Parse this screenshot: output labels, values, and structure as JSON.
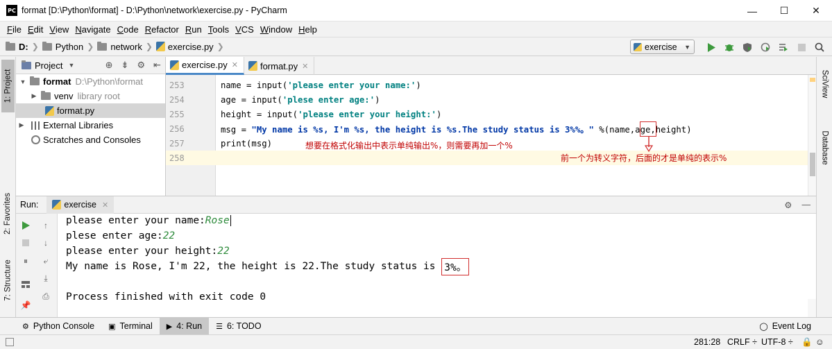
{
  "window": {
    "title": "format [D:\\Python\\format] - D:\\Python\\network\\exercise.py - PyCharm",
    "icon": "PC",
    "controls": {
      "minimize": "—",
      "maximize": "☐",
      "close": "✕"
    }
  },
  "menu": {
    "items": [
      {
        "first": "F",
        "rest": "ile"
      },
      {
        "first": "E",
        "rest": "dit"
      },
      {
        "first": "V",
        "rest": "iew"
      },
      {
        "first": "N",
        "rest": "avigate"
      },
      {
        "first": "C",
        "rest": "ode"
      },
      {
        "first": "R",
        "rest": "efactor"
      },
      {
        "first": "R",
        "rest": "un"
      },
      {
        "first": "T",
        "rest": "ools"
      },
      {
        "first": "V",
        "rest": "CS"
      },
      {
        "first": "W",
        "rest": "indow"
      },
      {
        "first": "H",
        "rest": "elp"
      }
    ]
  },
  "breadcrumb": {
    "drive": "D:",
    "folder1": "Python",
    "folder2": "network",
    "file": "exercise.py"
  },
  "run_config": {
    "label": "exercise"
  },
  "left_tool_tabs": {
    "project": "1: Project",
    "favorites": "2: Favorites",
    "structure": "7: Structure"
  },
  "right_tool_tabs": {
    "sciview": "SciView",
    "database": "Database"
  },
  "project_panel": {
    "header": "Project",
    "tree": {
      "root_name": "format",
      "root_path": "D:\\Python\\format",
      "venv": "venv",
      "venv_note": "library root",
      "file": "format.py",
      "external": "External Libraries",
      "scratches": "Scratches and Consoles"
    }
  },
  "editor_tabs": {
    "tab1": "exercise.py",
    "tab2": "format.py"
  },
  "code": {
    "lines": [
      {
        "no": "253",
        "pre": "name = input(",
        "str": "'please enter your name:'",
        "post": ")"
      },
      {
        "no": "254",
        "pre": "age = input(",
        "str": "'plese enter age:'",
        "post": ")"
      },
      {
        "no": "255",
        "pre": "height = input(",
        "str": "'please enter your height:'",
        "post": ")"
      },
      {
        "no": "256",
        "pre": "msg = ",
        "str": "\"My name is %s, I'm %s, the height is %s.The study status is 3%%。\"",
        "post": " %(name,age,height)"
      },
      {
        "no": "257",
        "pre": "print(msg)",
        "str": "",
        "post": ""
      },
      {
        "no": "258",
        "pre": "",
        "str": "",
        "post": ""
      }
    ]
  },
  "annotations": {
    "note1": "想要在格式化输出中表示单纯输出%，则需要再加一个%",
    "note2": "前一个为转义字符，后面的才是单纯的表示%"
  },
  "run_panel": {
    "label": "Run:",
    "tab": "exercise",
    "output": {
      "line1_prompt": "please enter your name:",
      "line1_input": "Rose",
      "line2_prompt": "plese enter age:",
      "line2_input": "22",
      "line3_prompt": "please enter your height:",
      "line3_input": "22",
      "line4_text": "My name is Rose, I'm 22, the height is 22.The study status is ",
      "line4_highlight": "3%。",
      "line5": "Process finished with exit code 0"
    }
  },
  "bottom_tabs": {
    "python_console": "Python Console",
    "terminal": "Terminal",
    "run": "4: Run",
    "todo": "6: TODO",
    "event_log": "Event Log"
  },
  "status": {
    "position": "281:28",
    "line_sep": "CRLF ÷",
    "encoding": "UTF-8 ÷"
  }
}
